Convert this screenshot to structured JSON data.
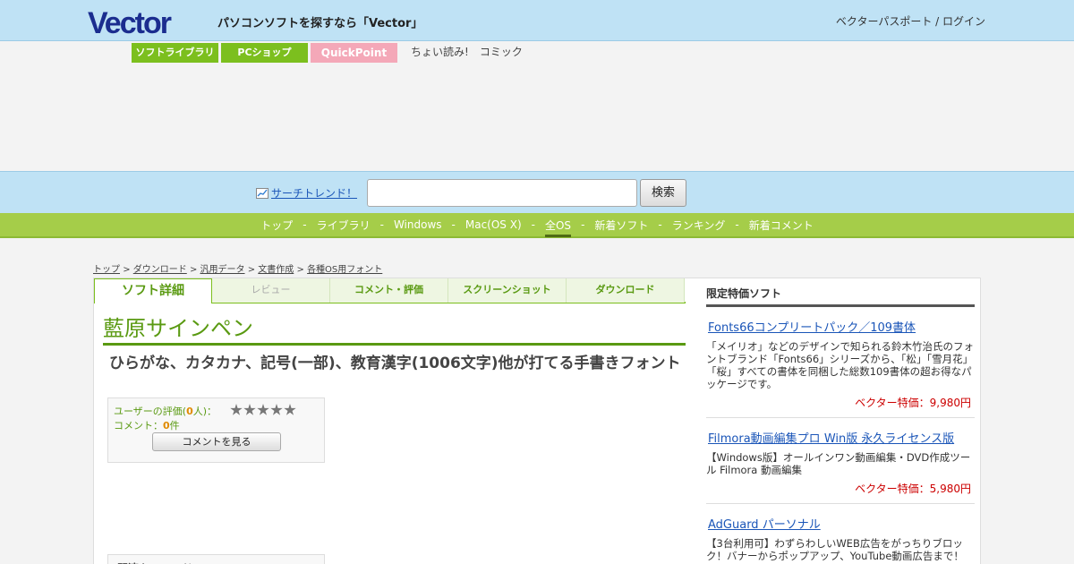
{
  "header": {
    "tagline": "パソコンソフトを探すなら「Vector」",
    "login": "ベクターパスポート / ログイン",
    "brand_color": "#1b2d8f"
  },
  "subnav": {
    "tabs": [
      "ソフトライブラリ",
      "PCショップ",
      "QuickPoint"
    ],
    "links": [
      "ちょい読み!",
      "コミック"
    ]
  },
  "search": {
    "trend": "サーチトレンド！",
    "button": "検索",
    "placeholder": ""
  },
  "gnav": {
    "items": [
      "トップ",
      "ライブラリ",
      "Windows",
      "Mac(OS X)",
      "全OS",
      "新着ソフト",
      "ランキング",
      "新着コメント"
    ],
    "separator": "-"
  },
  "breadcrumb": {
    "items": [
      "トップ",
      "ダウンロード",
      "汎用データ",
      "文書作成",
      "各種OS用フォント"
    ],
    "separator": ">"
  },
  "tabs": [
    "ソフト詳細",
    "レビュー",
    "コメント・評価",
    "スクリーンショット",
    "ダウンロード"
  ],
  "soft": {
    "title": "藍原サインペン",
    "subtitle": "ひらがな、カタカナ、記号(一部)、教育漢字(1006文字)他が打てる手書きフォント"
  },
  "rating": {
    "label_prefix": "ユーザーの評価(",
    "count": "0",
    "label_suffix": "人)：",
    "comment_prefix": "コメント：",
    "comment_count": "0",
    "comment_suffix": "件",
    "button": "コメントを見る",
    "stars": 0
  },
  "related": {
    "title": "関連キーワード"
  },
  "side": {
    "heading": "限定特価ソフト",
    "ads": [
      {
        "title": "Fonts66コンプリートパック／109書体",
        "desc": "「メイリオ」などのデザインで知られる鈴木竹治氏のフォントブランド「Fonts66」シリーズから、「松」「雪月花」「桜」すべての書体を同梱した総数109書体の超お得なパッケージです。",
        "price": "ベクター特価：9,980円"
      },
      {
        "title": "Filmora動画編集プロ Win版 永久ライセンス版",
        "desc": "【Windows版】オールインワン動画編集・DVD作成ツール Filmora 動画編集",
        "price": "ベクター特価：5,980円"
      },
      {
        "title": "AdGuard パーソナル",
        "desc": "【3台利用可】わずらわしいWEB広告をがっちりブロック！バナーからポップアップ、YouTube動画広告まで！",
        "price": ""
      }
    ]
  }
}
